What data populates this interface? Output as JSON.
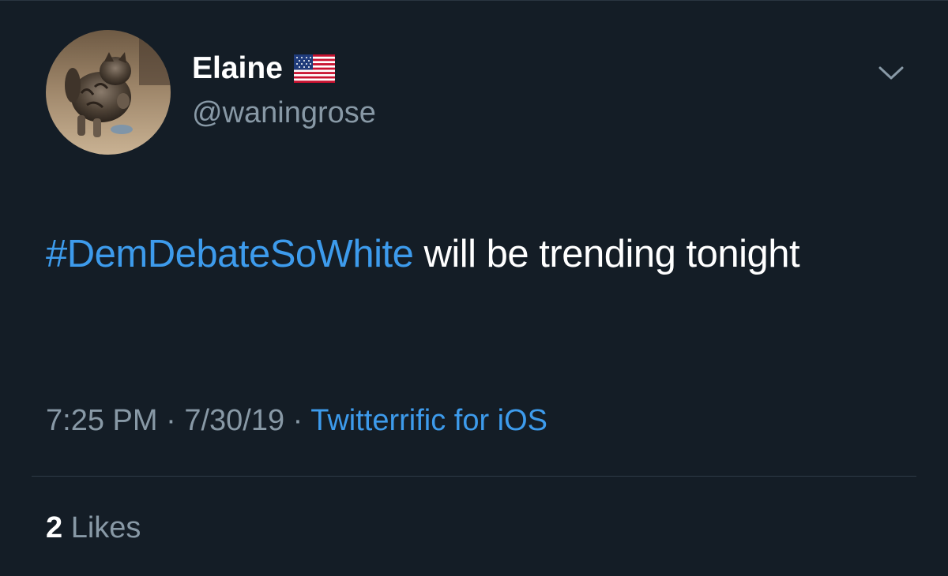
{
  "tweet": {
    "author": {
      "display_name": "Elaine",
      "flag_emoji": "🇺🇸",
      "handle": "@waningrose",
      "avatar_icon": "kitten-photo"
    },
    "menu_icon": "chevron-down-icon",
    "text": {
      "hashtag": "#DemDebateSoWhite",
      "body": " will be trending tonight"
    },
    "meta": {
      "time": "7:25 PM",
      "separator": " · ",
      "date": "7/30/19",
      "source": "Twitterrific for iOS"
    },
    "likes": {
      "count": "2",
      "label": " Likes"
    }
  },
  "colors": {
    "background": "#141d26",
    "link": "#3d9bec",
    "secondary_text": "#8899a6",
    "primary_text": "#ffffff"
  }
}
